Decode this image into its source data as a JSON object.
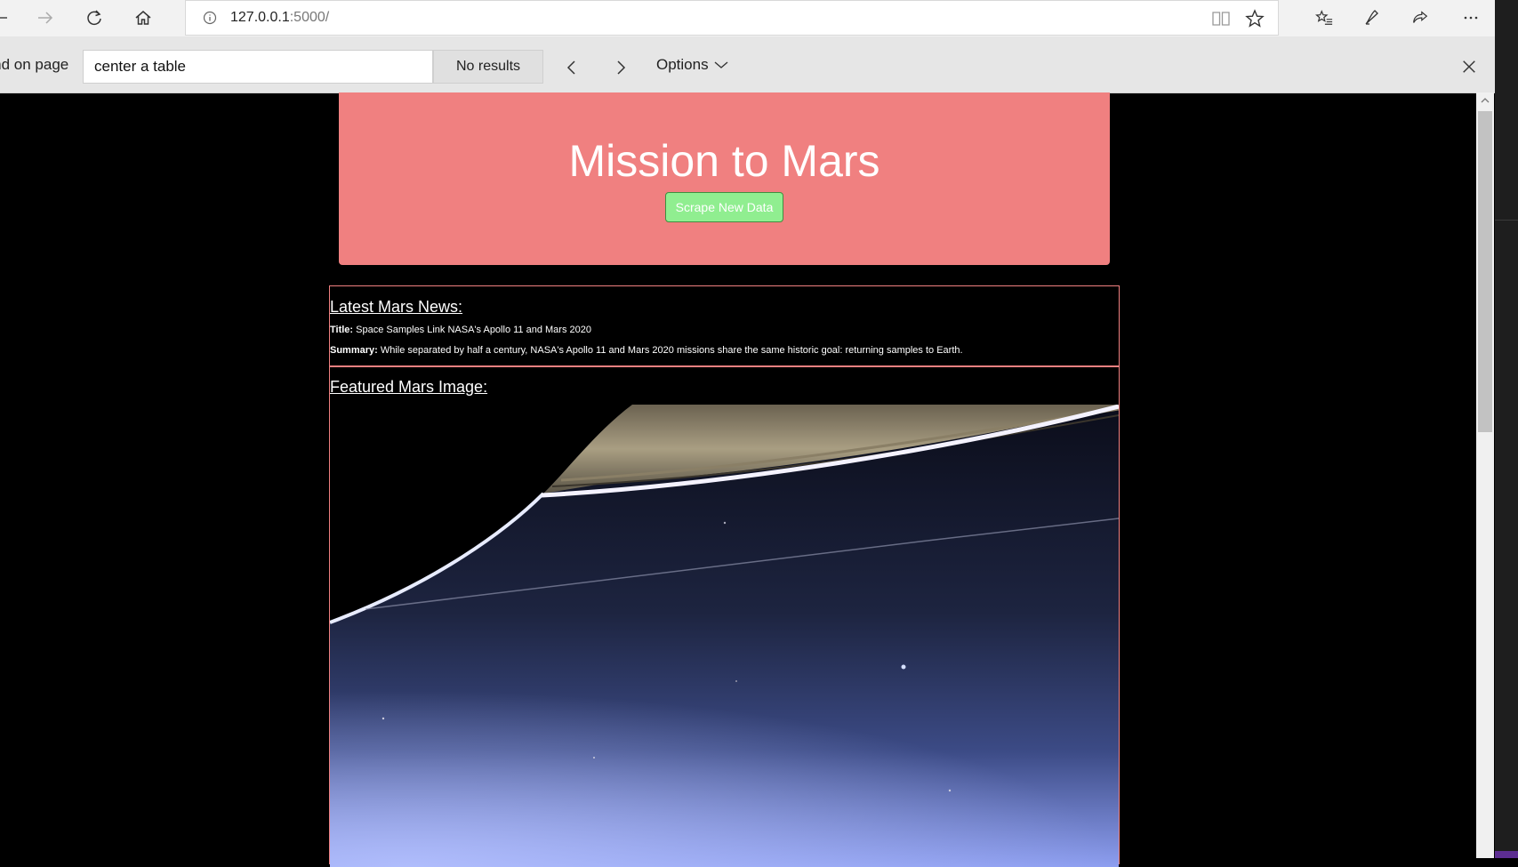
{
  "browser": {
    "url_host": "127.0.0.1",
    "url_port": ":5000/",
    "icons": [
      "back-icon",
      "forward-icon",
      "refresh-icon",
      "home-icon",
      "info-icon",
      "reading-view-icon",
      "favorite-star-icon",
      "favorites-list-icon",
      "pen-icon",
      "share-icon",
      "more-icon"
    ]
  },
  "findbar": {
    "label": "Find on page",
    "query": "center a table",
    "results": "No results",
    "options_label": "Options"
  },
  "page": {
    "title": "Mission to Mars",
    "scrape_button": "Scrape New Data",
    "news": {
      "heading": "Latest Mars News:",
      "title_label": "Title:",
      "title_text": "Space Samples Link NASA's Apollo 11 and Mars 2020",
      "summary_label": "Summary:",
      "summary_text": "While separated by half a century, NASA's Apollo 11 and Mars 2020 missions share the same historic goal: returning samples to Earth."
    },
    "featured_image_heading": "Featured Mars Image:"
  },
  "colors": {
    "jumbotron": "#f08080",
    "button": "#90ee90",
    "background": "#000000"
  }
}
